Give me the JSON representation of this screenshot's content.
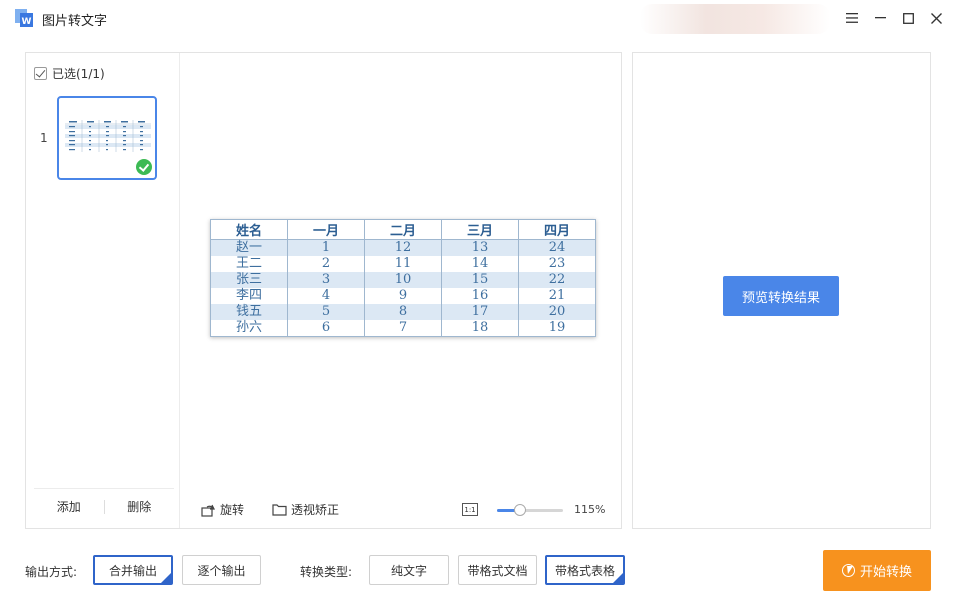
{
  "window": {
    "title": "图片转文字"
  },
  "left_panel": {
    "select_all_label": "已选(1/1)",
    "thumbnails": [
      {
        "index": "1"
      }
    ],
    "add_label": "添加",
    "delete_label": "删除"
  },
  "preview": {
    "table": {
      "headers": [
        "姓名",
        "一月",
        "二月",
        "三月",
        "四月"
      ],
      "rows": [
        [
          "赵一",
          "1",
          "12",
          "13",
          "24"
        ],
        [
          "王二",
          "2",
          "11",
          "14",
          "23"
        ],
        [
          "张三",
          "3",
          "10",
          "15",
          "22"
        ],
        [
          "李四",
          "4",
          "9",
          "16",
          "21"
        ],
        [
          "钱五",
          "5",
          "8",
          "17",
          "20"
        ],
        [
          "孙六",
          "6",
          "7",
          "18",
          "19"
        ]
      ]
    },
    "tools": {
      "rotate_label": "旋转",
      "perspective_label": "透视矫正",
      "fit_label": "1:1",
      "zoom_label": "115%",
      "zoom_slider_fraction": 0.35
    }
  },
  "right_panel": {
    "preview_button_label": "预览转换结果"
  },
  "bottom": {
    "output_mode_label": "输出方式:",
    "merge_output_label": "合并输出",
    "each_output_label": "逐个输出",
    "convert_type_label": "转换类型:",
    "plain_text_label": "纯文字",
    "formatted_doc_label": "带格式文档",
    "formatted_table_label": "带格式表格",
    "start_button_label": "开始转换"
  },
  "colors": {
    "accent_blue": "#4a86e8",
    "selected_border": "#2f64c9",
    "start_orange": "#f7921e",
    "success_green": "#3cba54"
  }
}
